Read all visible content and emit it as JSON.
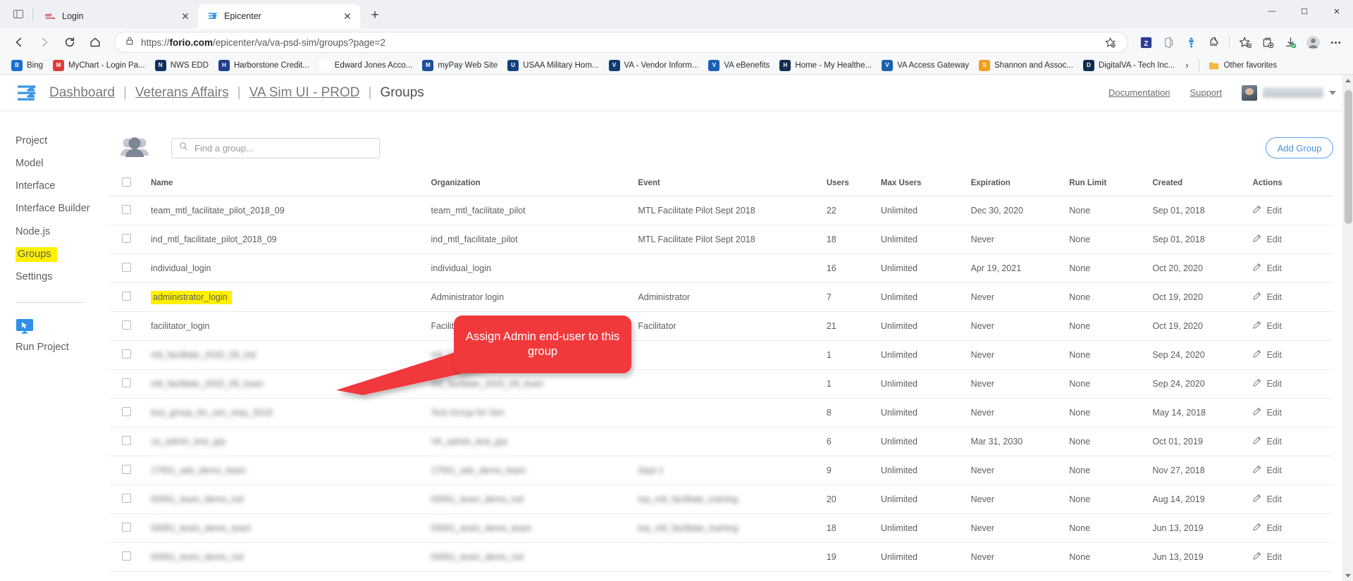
{
  "browser": {
    "tabs": [
      {
        "title": "Login",
        "favicon": "mtl-icon",
        "active": false
      },
      {
        "title": "Epicenter",
        "favicon": "epicenter-icon",
        "active": true
      }
    ],
    "new_tab_label": "+",
    "window_controls": {
      "minimize": "—",
      "maximize": "☐",
      "close": "✕"
    },
    "nav": {
      "back": "back-arrow-icon",
      "forward": "forward-arrow-icon",
      "reload": "reload-icon",
      "home": "home-icon"
    },
    "url_prefix": "https://",
    "url_domain": "forio.com",
    "url_path": "/epicenter/va/va-psd-sim/groups?page=2",
    "toolbar_icons": [
      "favorite-add-icon",
      "zotero-icon",
      "office-icon",
      "collections-icon",
      "extensions-icon",
      "favorites-icon",
      "collections-add-icon",
      "downloads-icon",
      "profile-icon",
      "settings-more-icon"
    ],
    "bookmarks": [
      {
        "label": "Bing",
        "icon": "bing-icon",
        "color": "#1b6fd4"
      },
      {
        "label": "MyChart - Login Pa...",
        "icon": "mychart-icon",
        "color": "#e03b3b"
      },
      {
        "label": "NWS EDD",
        "icon": "nws-icon",
        "color": "#12325e"
      },
      {
        "label": "Harborstone Credit...",
        "icon": "harborstone-icon",
        "color": "#1f3f8f"
      },
      {
        "label": "Edward Jones Acco...",
        "icon": "page-icon",
        "color": "#ffffff"
      },
      {
        "label": "myPay Web Site",
        "icon": "mypay-icon",
        "color": "#1f4e9c"
      },
      {
        "label": "USAA Military Hom...",
        "icon": "usaa-icon",
        "color": "#12427e"
      },
      {
        "label": "VA - Vendor Inform...",
        "icon": "va-vendor-icon",
        "color": "#123a73"
      },
      {
        "label": "VA eBenefits",
        "icon": "ebenefits-icon",
        "color": "#1a5fb4"
      },
      {
        "label": "Home - My Healthe...",
        "icon": "va-icon",
        "color": "#112e51"
      },
      {
        "label": "VA Access Gateway",
        "icon": "lock-icon",
        "color": "#1862ad"
      },
      {
        "label": "Shannon and Assoc...",
        "icon": "shannon-icon",
        "color": "#f0a01e"
      },
      {
        "label": "DigitalVA - Tech Inc...",
        "icon": "va-icon",
        "color": "#112e51"
      }
    ],
    "bookmarks_overflow": "›",
    "other_favorites": {
      "label": "Other favorites",
      "icon": "folder-icon"
    }
  },
  "header": {
    "logo": "epicenter-logo-icon",
    "breadcrumbs": [
      {
        "label": "Dashboard",
        "current": false
      },
      {
        "label": "Veterans Affairs",
        "current": false
      },
      {
        "label": "VA Sim UI - PROD",
        "current": false
      },
      {
        "label": "Groups",
        "current": true
      }
    ],
    "separator": "|",
    "documentation_label": "Documentation",
    "support_label": "Support",
    "user_menu_caret": "chevron-down-icon"
  },
  "sidebar": {
    "items": [
      {
        "label": "Project",
        "highlighted": false
      },
      {
        "label": "Model",
        "highlighted": false
      },
      {
        "label": "Interface",
        "highlighted": false
      },
      {
        "label": "Interface Builder",
        "highlighted": false
      },
      {
        "label": "Node.js",
        "highlighted": false
      },
      {
        "label": "Groups",
        "highlighted": true
      },
      {
        "label": "Settings",
        "highlighted": false
      }
    ],
    "run_project_label": "Run Project",
    "run_project_icon": "monitor-cursor-icon"
  },
  "toolbar": {
    "group_icon": "group-people-icon",
    "search_placeholder": "Find a group...",
    "search_value": "",
    "search_icon": "search-icon",
    "add_group_label": "Add Group"
  },
  "callout": {
    "text": "Assign Admin end-user to this group",
    "color": "#f1393c"
  },
  "highlight_color": "#fff000",
  "table": {
    "columns": [
      "Name",
      "Organization",
      "Event",
      "Users",
      "Max Users",
      "Expiration",
      "Run Limit",
      "Created",
      "Actions"
    ],
    "edit_label": "Edit",
    "edit_icon": "pencil-icon",
    "rows": [
      {
        "name": "team_mtl_facilitate_pilot_2018_09",
        "blur_name": false,
        "highlight_name": false,
        "organization": "team_mtl_facilitate_pilot",
        "blur_org": false,
        "event": "MTL Facilitate Pilot Sept 2018",
        "users": "22",
        "max_users": "Unlimited",
        "expiration": "Dec 30, 2020",
        "run_limit": "None",
        "created": "Sep 01, 2018"
      },
      {
        "name": "ind_mtl_facilitate_pilot_2018_09",
        "blur_name": false,
        "highlight_name": false,
        "organization": "ind_mtl_facilitate_pilot",
        "blur_org": false,
        "event": "MTL Facilitate Pilot Sept 2018",
        "users": "18",
        "max_users": "Unlimited",
        "expiration": "Never",
        "run_limit": "None",
        "created": "Sep 01, 2018"
      },
      {
        "name": "individual_login",
        "blur_name": false,
        "highlight_name": false,
        "organization": "individual_login",
        "blur_org": false,
        "event": "",
        "users": "16",
        "max_users": "Unlimited",
        "expiration": "Apr 19, 2021",
        "run_limit": "None",
        "created": "Oct 20, 2020"
      },
      {
        "name": "administrator_login",
        "blur_name": false,
        "highlight_name": true,
        "organization": "Administrator login",
        "blur_org": false,
        "event": "Administrator",
        "users": "7",
        "max_users": "Unlimited",
        "expiration": "Never",
        "run_limit": "None",
        "created": "Oct 19, 2020"
      },
      {
        "name": "facilitator_login",
        "blur_name": false,
        "highlight_name": false,
        "organization": "Facilitator Login",
        "blur_org": false,
        "event": "Facilitator",
        "users": "21",
        "max_users": "Unlimited",
        "expiration": "Never",
        "run_limit": "None",
        "created": "Oct 19, 2020"
      },
      {
        "name": "mtl_facilitate_2020_09_ind",
        "blur_name": true,
        "highlight_name": false,
        "organization": "mtl_facilitate_2020_09_ind",
        "blur_org": true,
        "event": "",
        "users": "1",
        "max_users": "Unlimited",
        "expiration": "Never",
        "run_limit": "None",
        "created": "Sep 24, 2020"
      },
      {
        "name": "mtl_facilitate_2020_09_team",
        "blur_name": true,
        "highlight_name": false,
        "organization": "mtl_facilitate_2020_09_team",
        "blur_org": true,
        "event": "",
        "users": "1",
        "max_users": "Unlimited",
        "expiration": "Never",
        "run_limit": "None",
        "created": "Sep 24, 2020"
      },
      {
        "name": "test_group_for_sim_may_2018",
        "blur_name": true,
        "highlight_name": false,
        "organization": "Test Group for Sim",
        "blur_org": true,
        "event": "",
        "users": "8",
        "max_users": "Unlimited",
        "expiration": "Never",
        "run_limit": "None",
        "created": "May 14, 2018"
      },
      {
        "name": "va_admin_test_grp",
        "blur_name": true,
        "highlight_name": false,
        "organization": "VA_admin_test_grp",
        "blur_org": true,
        "event": "",
        "users": "6",
        "max_users": "Unlimited",
        "expiration": "Mar 31, 2030",
        "run_limit": "None",
        "created": "Oct 01, 2019"
      },
      {
        "name": "17001_adv_demo_team",
        "blur_name": true,
        "highlight_name": false,
        "organization": "17001_adv_demo_team",
        "blur_org": true,
        "event": "Sept 1",
        "users": "9",
        "max_users": "Unlimited",
        "expiration": "Never",
        "run_limit": "None",
        "created": "Nov 27, 2018"
      },
      {
        "name": "00061_team_demo_ind",
        "blur_name": true,
        "highlight_name": false,
        "organization": "00061_team_demo_ind",
        "blur_org": true,
        "event": "top_mtl_facilitate_training",
        "users": "20",
        "max_users": "Unlimited",
        "expiration": "Never",
        "run_limit": "None",
        "created": "Aug 14, 2019"
      },
      {
        "name": "00061_team_demo_team",
        "blur_name": true,
        "highlight_name": false,
        "organization": "00061_team_demo_team",
        "blur_org": true,
        "event": "top_mtl_facilitate_training",
        "users": "18",
        "max_users": "Unlimited",
        "expiration": "Never",
        "run_limit": "None",
        "created": "Jun 13, 2019"
      },
      {
        "name": "00061_team_demo_ind",
        "blur_name": true,
        "highlight_name": false,
        "organization": "00061_team_demo_ind",
        "blur_org": true,
        "event": "",
        "users": "19",
        "max_users": "Unlimited",
        "expiration": "Never",
        "run_limit": "None",
        "created": "Jun 13, 2019"
      }
    ]
  }
}
